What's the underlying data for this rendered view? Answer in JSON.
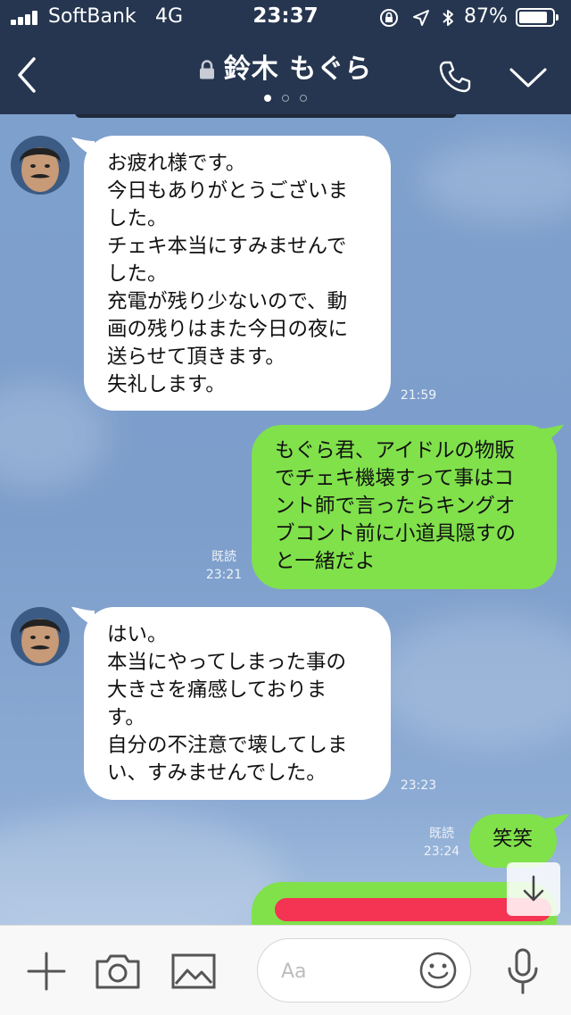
{
  "status_bar": {
    "carrier": "SoftBank",
    "network": "4G",
    "time": "23:37",
    "battery_percent": "87%",
    "battery_level": 0.87,
    "icons": [
      "signal-icon",
      "orientation-lock-icon",
      "location-icon",
      "bluetooth-icon",
      "battery-icon"
    ]
  },
  "header": {
    "title": "鈴木 もぐら",
    "icons": [
      "back-icon",
      "lock-icon",
      "call-icon",
      "chevron-down-icon"
    ],
    "page_indicator": {
      "count": 3,
      "active": 1
    }
  },
  "messages": [
    {
      "direction": "incoming",
      "lines": [
        "お疲れ様です。",
        "今日もありがとうございま",
        "した。",
        "チェキ本当にすみませんで",
        "した。",
        "充電が残り少ないので、動",
        "画の残りはまた今日の夜に",
        "送らせて頂きます。",
        "失礼します。"
      ],
      "time": "21:59"
    },
    {
      "direction": "outgoing",
      "lines": [
        "もぐら君、アイドルの物販",
        "でチェキ機壊すって事はコ",
        "ント師で言ったらキングオ",
        "ブコント前に小道具隠すの",
        "と一緒だよ"
      ],
      "read": "既読",
      "time": "23:21"
    },
    {
      "direction": "incoming",
      "lines": [
        "はい。",
        "本当にやってしまった事の",
        "大きさを痛感しておりま",
        "す。",
        "自分の不注意で壊してしま",
        "い、すみませんでした。"
      ],
      "time": "23:23"
    },
    {
      "direction": "outgoing",
      "lines": [
        "笑笑"
      ],
      "read": "既読",
      "time": "23:24"
    }
  ],
  "colors": {
    "header_bg": "#263650",
    "chat_bg": "#7ea0cd",
    "outgoing_bubble": "#80e14b",
    "incoming_bubble": "#ffffff",
    "redaction": "#f43452"
  },
  "input_bar": {
    "placeholder": "Aa",
    "icons": [
      "plus-icon",
      "camera-icon",
      "image-icon",
      "emoji-icon",
      "microphone-icon"
    ]
  }
}
